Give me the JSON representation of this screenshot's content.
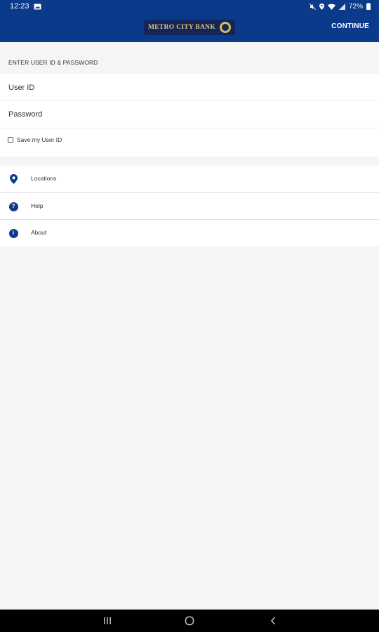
{
  "status_bar": {
    "time": "12:23",
    "battery": "72%",
    "icons": [
      "image-icon",
      "mute-icon",
      "location-icon",
      "wifi-icon",
      "signal-icon",
      "battery-icon"
    ]
  },
  "app_bar": {
    "logo_text": "METRO CITY BANK",
    "continue_label": "CONTINUE",
    "background": "#0b3a8a"
  },
  "login": {
    "heading": "ENTER USER ID & PASSWORD",
    "user_id_placeholder": "User ID",
    "user_id_value": "",
    "password_placeholder": "Password",
    "password_value": "",
    "save_user_id_label": "Save my User ID",
    "save_user_id_checked": false
  },
  "menu": {
    "items": [
      {
        "label": "Locations",
        "icon": "location-pin-icon"
      },
      {
        "label": "Help",
        "icon": "help-icon",
        "glyph": "?"
      },
      {
        "label": "About",
        "icon": "info-icon",
        "glyph": "i"
      }
    ]
  },
  "nav_bar": {
    "buttons": [
      "recents-icon",
      "home-icon",
      "back-icon"
    ]
  },
  "colors": {
    "brand": "#0b3a8a",
    "logo_bg": "#13255a",
    "logo_gold": "#d9b85e",
    "page_bg": "#f5f5f5"
  }
}
